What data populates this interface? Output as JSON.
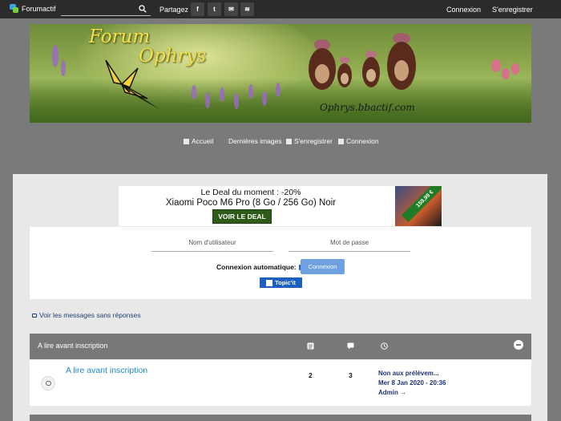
{
  "topbar": {
    "brand": "Forumactif",
    "search_placeholder": "",
    "share_label": "Partagez :",
    "share_buttons": [
      {
        "label": "f",
        "icon": "facebook-icon"
      },
      {
        "label": "t",
        "icon": "twitter-icon"
      },
      {
        "label": "✉",
        "icon": "mail-icon"
      },
      {
        "label": "≋",
        "icon": "rss-icon"
      }
    ],
    "login": "Connexion",
    "register": "S'enregistrer"
  },
  "banner": {
    "title_line1": "Forum",
    "title_line2": "Ophrys",
    "url": "Ophrys.bbactif.com"
  },
  "nav": {
    "home": "Accueil",
    "latest_images": "Dernières images",
    "register": "S'enregistrer",
    "login": "Connexion"
  },
  "ad": {
    "line1": "Le Deal du moment : -20%",
    "line2": "Xiaomi Poco M6 Pro (8 Go / 256 Go) Noir",
    "button": "VOIR LE DEAL",
    "price": "159,99 €"
  },
  "login_box": {
    "username_placeholder": "Nom d'utilisateur",
    "password_placeholder": "Mot de passe",
    "auto_login": "Connexion automatique:",
    "submit": "Connexion",
    "topicit": "Topic'it"
  },
  "links": {
    "unanswered": "Voir les messages sans réponses"
  },
  "category": {
    "title": "A lire avant inscription",
    "forums": [
      {
        "name": "A lire avant inscription",
        "topics": "2",
        "posts": "3",
        "last_title": "Non aux prélèvem...",
        "last_date": "Mer 8 Jan 2020 - 20:36",
        "last_author": "Admin →"
      }
    ]
  },
  "colors": {
    "topbar": "#2b2b2b",
    "page_bg": "#7a7a7a",
    "panel": "#e8e8e8",
    "category_header": "#787878",
    "link_blue": "#1e88c8",
    "deal_green": "#2f5b18",
    "title_yellow": "#f4e04a"
  }
}
